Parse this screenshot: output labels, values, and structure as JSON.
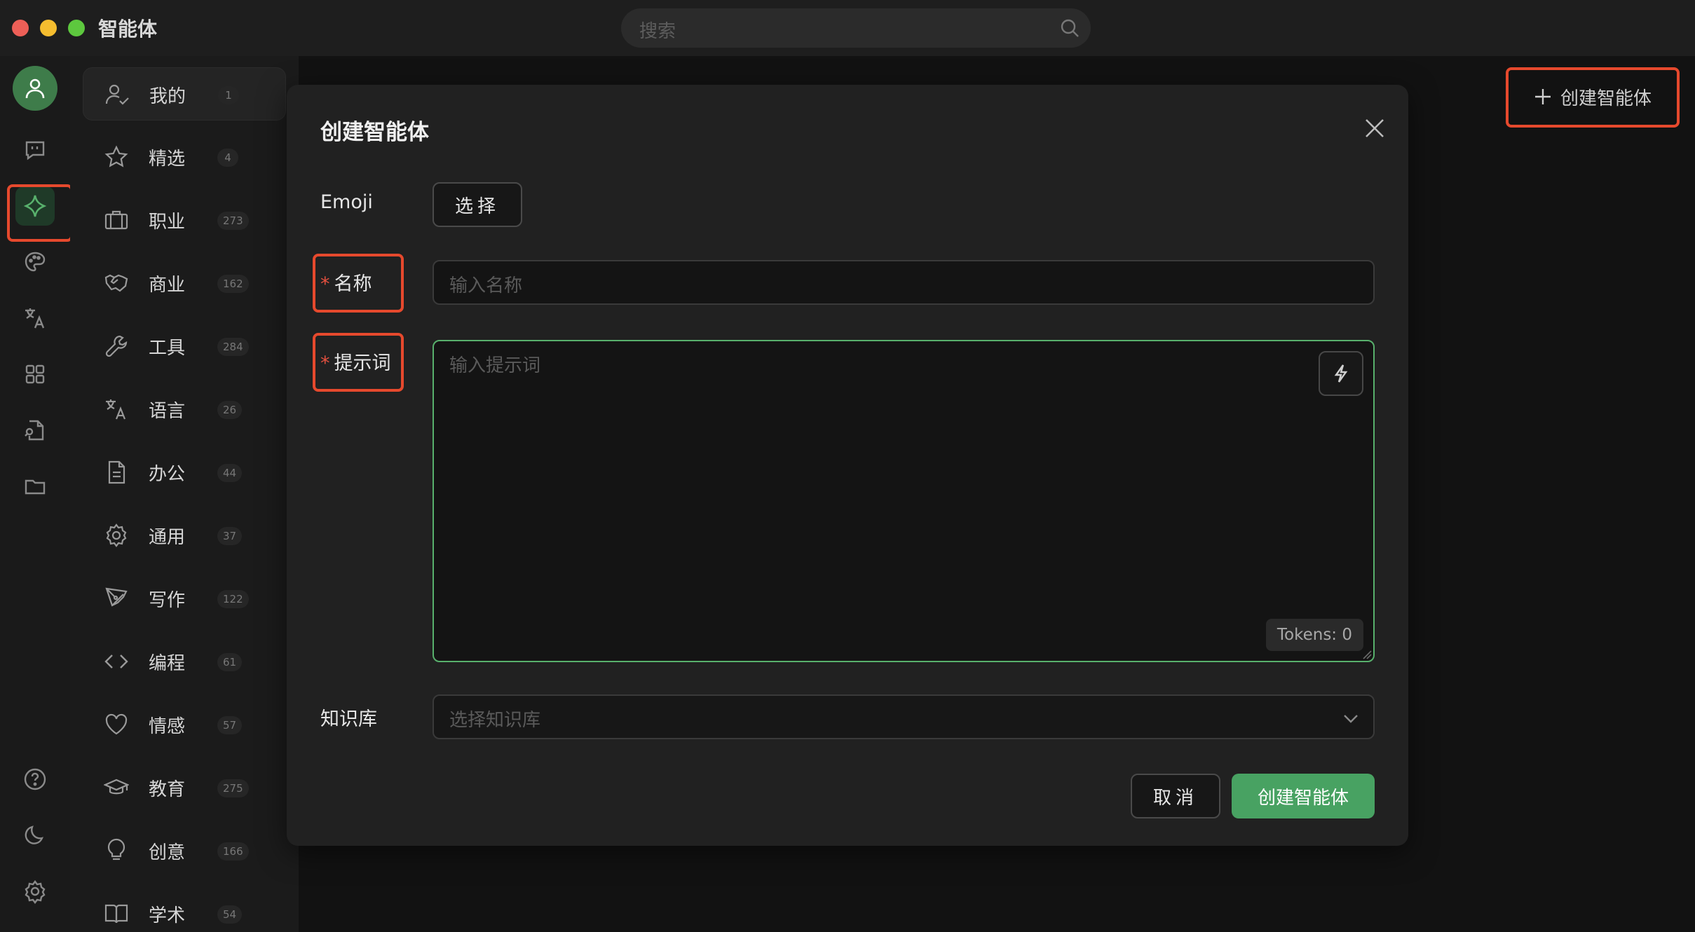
{
  "window": {
    "title": "智能体"
  },
  "search": {
    "placeholder": "搜索"
  },
  "categories": [
    {
      "label": "我的",
      "count": "1",
      "icon": "user-check-icon"
    },
    {
      "label": "精选",
      "count": "4",
      "icon": "star-icon"
    },
    {
      "label": "职业",
      "count": "273",
      "icon": "briefcase-icon"
    },
    {
      "label": "商业",
      "count": "162",
      "icon": "handshake-icon"
    },
    {
      "label": "工具",
      "count": "284",
      "icon": "wrench-icon"
    },
    {
      "label": "语言",
      "count": "26",
      "icon": "translate-icon"
    },
    {
      "label": "办公",
      "count": "44",
      "icon": "document-icon"
    },
    {
      "label": "通用",
      "count": "37",
      "icon": "gear-icon"
    },
    {
      "label": "写作",
      "count": "122",
      "icon": "pen-icon"
    },
    {
      "label": "编程",
      "count": "61",
      "icon": "code-icon"
    },
    {
      "label": "情感",
      "count": "57",
      "icon": "heart-icon"
    },
    {
      "label": "教育",
      "count": "275",
      "icon": "graduation-cap-icon"
    },
    {
      "label": "创意",
      "count": "166",
      "icon": "lightbulb-icon"
    },
    {
      "label": "学术",
      "count": "54",
      "icon": "book-icon"
    }
  ],
  "header": {
    "create_label": "创建智能体"
  },
  "modal": {
    "title": "创建智能体",
    "emoji_label": "Emoji",
    "emoji_button": "选择",
    "name_label": "名称",
    "name_placeholder": "输入名称",
    "prompt_label": "提示词",
    "prompt_placeholder": "输入提示词",
    "tokens_label": "Tokens: 0",
    "kb_label": "知识库",
    "kb_placeholder": "选择知识库",
    "cancel_label": "取消",
    "submit_label": "创建智能体",
    "required_mark": "*"
  },
  "colors": {
    "accent": "#48a262",
    "highlight": "#e6492d",
    "background": "#111111"
  }
}
